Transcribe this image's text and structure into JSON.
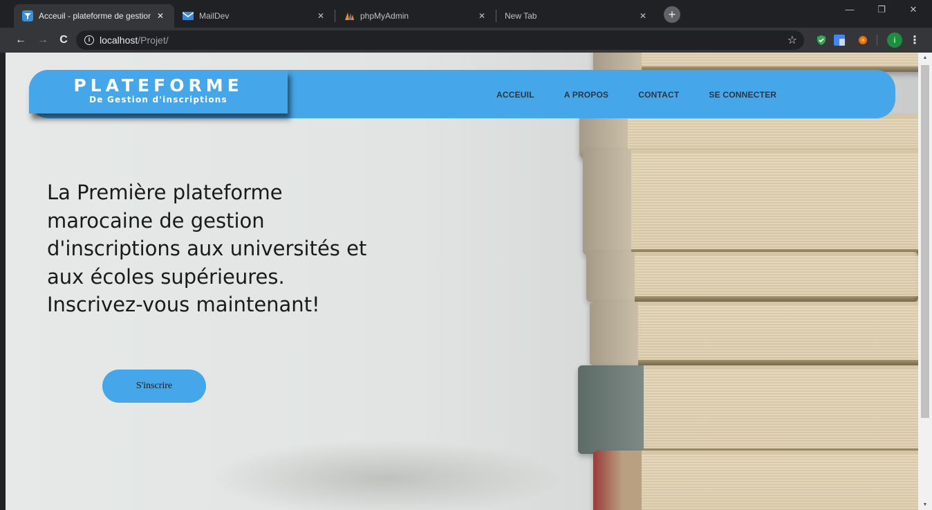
{
  "browser": {
    "tabs": [
      {
        "title": "Acceuil - plateforme de gestion d'i",
        "active": true,
        "favicon": "funnel-icon"
      },
      {
        "title": "MailDev",
        "active": false,
        "favicon": "mail-icon"
      },
      {
        "title": "phpMyAdmin",
        "active": false,
        "favicon": "sail-icon"
      },
      {
        "title": "New Tab",
        "active": false,
        "favicon": ""
      }
    ],
    "close_glyph": "✕",
    "new_tab_glyph": "+",
    "window_controls": {
      "minimize": "—",
      "restore": "❐",
      "close": "✕"
    },
    "nav": {
      "back": "←",
      "forward": "→",
      "reload": "C"
    },
    "address": {
      "host": "localhost",
      "path": "/Projet/"
    },
    "star_glyph": "☆",
    "profile_initial": "i",
    "menu_glyph": "⋮",
    "colors": {
      "chrome_dark": "#202124",
      "toolbar": "#35363a"
    }
  },
  "site": {
    "logo": {
      "title": "PLATEFORME",
      "subtitle": "De Gestion d'inscriptions"
    },
    "menu": [
      "ACCEUIL",
      "A PROPOS",
      "CONTACT",
      "SE CONNECTER"
    ],
    "hero": {
      "lines": [
        "La Première plateforme",
        "marocaine de gestion",
        "d'inscriptions aux universités et",
        "aux écoles supérieures.",
        "Inscrivez-vous maintenant!"
      ],
      "cta": "S'inscrire"
    },
    "colors": {
      "accent": "#45a6ea",
      "text": "#1a1a1a"
    }
  }
}
